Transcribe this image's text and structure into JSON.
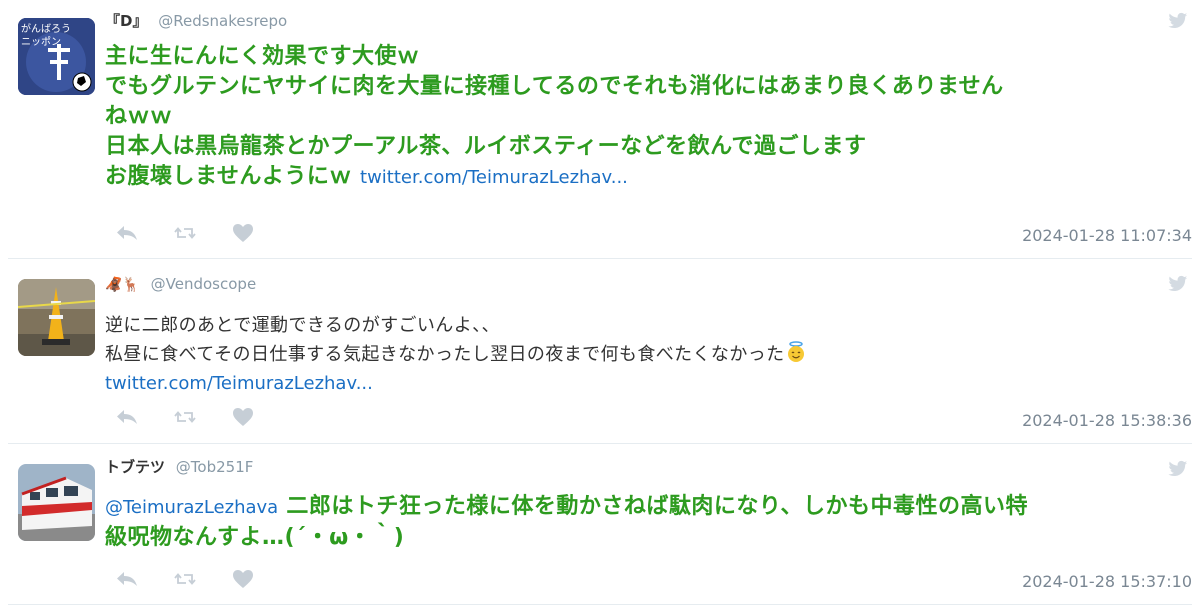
{
  "tweets": [
    {
      "display_name": "『D』",
      "handle": "@Redsnakesrepo",
      "avatar_text_top": "がんばろう",
      "avatar_text_mid": "ニッポン",
      "lines": [
        "主に生にんにく効果です大使ｗ",
        "でもグルテンにヤサイに肉を大量に接種してるのでそれも消化にはあまり良くありません",
        "ねｗｗ",
        "日本人は黒烏龍茶とかプーアル茶、ルイボスティーなどを飲んで過ごします",
        "お腹壊しませんようにｗ"
      ],
      "link": "twitter.com/TeimurazLezhav...",
      "timestamp": "2024-01-28 11:07:34"
    },
    {
      "display_name": "🦧🦌",
      "handle": "@Vendoscope",
      "lines": [
        "逆に二郎のあとで運動できるのがすごいんよ、、",
        "私昼に食べてその日仕事する気起きなかったし翌日の夜まで何も食べたくなかった"
      ],
      "link": "twitter.com/TeimurazLezhav...",
      "timestamp": "2024-01-28 15:38:36"
    },
    {
      "display_name": "トブテツ",
      "handle": "@Tob251F",
      "mention": "@TeimurazLezhava",
      "lines": [
        "二郎はトチ狂った様に体を動かさねば駄肉になり、しかも中毒性の高い特",
        "級呪物なんすよ…(´・ω・｀)"
      ],
      "timestamp": "2024-01-28 15:37:10"
    }
  ],
  "colors": {
    "accent_green": "#2d9b1f",
    "link_blue": "#1b6fc4",
    "muted_gray": "#8899a6",
    "divider": "#e6ecf0"
  },
  "icons": [
    "reply-icon",
    "retweet-icon",
    "like-icon",
    "twitter-bird-icon"
  ]
}
